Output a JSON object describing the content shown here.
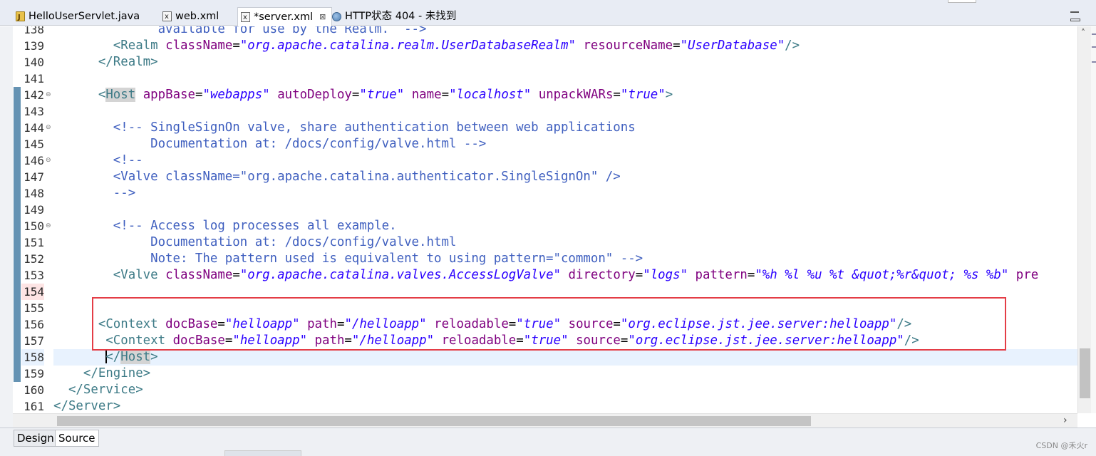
{
  "tabs": [
    {
      "label": "HelloUserServlet.java",
      "icon": "java-file-icon",
      "active": false
    },
    {
      "label": "web.xml",
      "icon": "xml-file-icon",
      "active": false
    },
    {
      "label": "*server.xml",
      "icon": "xml-file-icon",
      "active": true,
      "close": "⊠"
    },
    {
      "label": "HTTP状态 404 - 未找到",
      "icon": "web-browser-icon",
      "active": false
    }
  ],
  "editor": {
    "lines": [
      {
        "num": "138",
        "fold": "",
        "segments": [
          {
            "t": "cmt",
            "v": "              available for use by the Realm.  -->"
          }
        ]
      },
      {
        "num": "139",
        "fold": "",
        "segments": [
          {
            "t": "txt",
            "v": "        "
          },
          {
            "t": "bkt",
            "v": "<"
          },
          {
            "t": "tag",
            "v": "Realm"
          },
          {
            "t": "txt",
            "v": " "
          },
          {
            "t": "attr",
            "v": "className"
          },
          {
            "t": "txt",
            "v": "="
          },
          {
            "t": "val",
            "v": "\"org.apache.catalina.realm.UserDatabaseRealm\""
          },
          {
            "t": "txt",
            "v": " "
          },
          {
            "t": "attr",
            "v": "resourceName"
          },
          {
            "t": "txt",
            "v": "="
          },
          {
            "t": "val",
            "v": "\"UserDatabase\""
          },
          {
            "t": "bkt",
            "v": "/>"
          }
        ]
      },
      {
        "num": "140",
        "fold": "",
        "segments": [
          {
            "t": "txt",
            "v": "      "
          },
          {
            "t": "bkt",
            "v": "</"
          },
          {
            "t": "tag",
            "v": "Realm"
          },
          {
            "t": "bkt",
            "v": ">"
          }
        ]
      },
      {
        "num": "141",
        "fold": "",
        "segments": []
      },
      {
        "num": "142",
        "fold": "⊖",
        "segments": [
          {
            "t": "txt",
            "v": "      "
          },
          {
            "t": "bkt",
            "v": "<"
          },
          {
            "t": "taghl",
            "v": "Host"
          },
          {
            "t": "txt",
            "v": " "
          },
          {
            "t": "attr",
            "v": "appBase"
          },
          {
            "t": "txt",
            "v": "="
          },
          {
            "t": "val",
            "v": "\"webapps\""
          },
          {
            "t": "txt",
            "v": " "
          },
          {
            "t": "attr",
            "v": "autoDeploy"
          },
          {
            "t": "txt",
            "v": "="
          },
          {
            "t": "val",
            "v": "\"true\""
          },
          {
            "t": "txt",
            "v": " "
          },
          {
            "t": "attr",
            "v": "name"
          },
          {
            "t": "txt",
            "v": "="
          },
          {
            "t": "val",
            "v": "\"localhost\""
          },
          {
            "t": "txt",
            "v": " "
          },
          {
            "t": "attr",
            "v": "unpackWARs"
          },
          {
            "t": "txt",
            "v": "="
          },
          {
            "t": "val",
            "v": "\"true\""
          },
          {
            "t": "bkt",
            "v": ">"
          }
        ]
      },
      {
        "num": "143",
        "fold": "",
        "segments": []
      },
      {
        "num": "144",
        "fold": "⊖",
        "segments": [
          {
            "t": "cmt",
            "v": "        <!-- SingleSignOn valve, share authentication between web applications"
          }
        ]
      },
      {
        "num": "145",
        "fold": "",
        "segments": [
          {
            "t": "cmt",
            "v": "             Documentation at: /docs/config/valve.html -->"
          }
        ]
      },
      {
        "num": "146",
        "fold": "⊖",
        "segments": [
          {
            "t": "cmt",
            "v": "        <!--"
          }
        ]
      },
      {
        "num": "147",
        "fold": "",
        "segments": [
          {
            "t": "cmt",
            "v": "        <Valve className=\"org.apache.catalina.authenticator.SingleSignOn\" />"
          }
        ]
      },
      {
        "num": "148",
        "fold": "",
        "segments": [
          {
            "t": "cmt",
            "v": "        -->"
          }
        ]
      },
      {
        "num": "149",
        "fold": "",
        "segments": []
      },
      {
        "num": "150",
        "fold": "⊖",
        "segments": [
          {
            "t": "cmt",
            "v": "        <!-- Access log processes all example."
          }
        ]
      },
      {
        "num": "151",
        "fold": "",
        "segments": [
          {
            "t": "cmt",
            "v": "             Documentation at: /docs/config/valve.html"
          }
        ]
      },
      {
        "num": "152",
        "fold": "",
        "segments": [
          {
            "t": "cmt",
            "v": "             Note: The pattern used is equivalent to using pattern=\"common\" -->"
          }
        ]
      },
      {
        "num": "153",
        "fold": "",
        "segments": [
          {
            "t": "txt",
            "v": "        "
          },
          {
            "t": "bkt",
            "v": "<"
          },
          {
            "t": "tag",
            "v": "Valve"
          },
          {
            "t": "txt",
            "v": " "
          },
          {
            "t": "attr",
            "v": "className"
          },
          {
            "t": "txt",
            "v": "="
          },
          {
            "t": "val",
            "v": "\"org.apache.catalina.valves.AccessLogValve\""
          },
          {
            "t": "txt",
            "v": " "
          },
          {
            "t": "attr",
            "v": "directory"
          },
          {
            "t": "txt",
            "v": "="
          },
          {
            "t": "val",
            "v": "\"logs\""
          },
          {
            "t": "txt",
            "v": " "
          },
          {
            "t": "attr",
            "v": "pattern"
          },
          {
            "t": "txt",
            "v": "="
          },
          {
            "t": "val",
            "v": "\"%h %l %u %t &quot;%r&quot; %s %b\""
          },
          {
            "t": "txt",
            "v": " "
          },
          {
            "t": "attr",
            "v": "pre"
          }
        ]
      },
      {
        "num": "154",
        "fold": "",
        "dirty": true,
        "segments": []
      },
      {
        "num": "155",
        "fold": "",
        "segments": []
      },
      {
        "num": "156",
        "fold": "",
        "segments": [
          {
            "t": "txt",
            "v": "      "
          },
          {
            "t": "bkt",
            "v": "<"
          },
          {
            "t": "tag",
            "v": "Context"
          },
          {
            "t": "txt",
            "v": " "
          },
          {
            "t": "attr",
            "v": "docBase"
          },
          {
            "t": "txt",
            "v": "="
          },
          {
            "t": "val",
            "v": "\"helloapp\""
          },
          {
            "t": "txt",
            "v": " "
          },
          {
            "t": "attr",
            "v": "path"
          },
          {
            "t": "txt",
            "v": "="
          },
          {
            "t": "val",
            "v": "\"/helloapp\""
          },
          {
            "t": "txt",
            "v": " "
          },
          {
            "t": "attr",
            "v": "reloadable"
          },
          {
            "t": "txt",
            "v": "="
          },
          {
            "t": "val",
            "v": "\"true\""
          },
          {
            "t": "txt",
            "v": " "
          },
          {
            "t": "attr",
            "v": "source"
          },
          {
            "t": "txt",
            "v": "="
          },
          {
            "t": "val",
            "v": "\"org.eclipse.jst.jee.server:helloapp\""
          },
          {
            "t": "bkt",
            "v": "/>"
          }
        ]
      },
      {
        "num": "157",
        "fold": "",
        "segments": [
          {
            "t": "txt",
            "v": "       "
          },
          {
            "t": "bkt",
            "v": "<"
          },
          {
            "t": "tag",
            "v": "Context"
          },
          {
            "t": "txt",
            "v": " "
          },
          {
            "t": "attr",
            "v": "docBase"
          },
          {
            "t": "txt",
            "v": "="
          },
          {
            "t": "val",
            "v": "\"helloapp\""
          },
          {
            "t": "txt",
            "v": " "
          },
          {
            "t": "attr",
            "v": "path"
          },
          {
            "t": "txt",
            "v": "="
          },
          {
            "t": "val",
            "v": "\"/helloapp\""
          },
          {
            "t": "txt",
            "v": " "
          },
          {
            "t": "attr",
            "v": "reloadable"
          },
          {
            "t": "txt",
            "v": "="
          },
          {
            "t": "val",
            "v": "\"true\""
          },
          {
            "t": "txt",
            "v": " "
          },
          {
            "t": "attr",
            "v": "source"
          },
          {
            "t": "txt",
            "v": "="
          },
          {
            "t": "val",
            "v": "\"org.eclipse.jst.jee.server:helloapp\""
          },
          {
            "t": "bkt",
            "v": "/>"
          }
        ]
      },
      {
        "num": "158",
        "fold": "",
        "current": true,
        "segments": [
          {
            "t": "txt",
            "v": "       "
          },
          {
            "t": "caret",
            "v": ""
          },
          {
            "t": "bkt",
            "v": "</"
          },
          {
            "t": "taghl",
            "v": "Host"
          },
          {
            "t": "bkt",
            "v": ">"
          }
        ]
      },
      {
        "num": "159",
        "fold": "",
        "segments": [
          {
            "t": "txt",
            "v": "    "
          },
          {
            "t": "bkt",
            "v": "</"
          },
          {
            "t": "tag",
            "v": "Engine"
          },
          {
            "t": "bkt",
            "v": ">"
          }
        ]
      },
      {
        "num": "160",
        "fold": "",
        "segments": [
          {
            "t": "txt",
            "v": "  "
          },
          {
            "t": "bkt",
            "v": "</"
          },
          {
            "t": "tag",
            "v": "Service"
          },
          {
            "t": "bkt",
            "v": ">"
          }
        ]
      },
      {
        "num": "161",
        "fold": "",
        "segments": [
          {
            "t": "bkt",
            "v": "</"
          },
          {
            "t": "tag",
            "v": "Server"
          },
          {
            "t": "bkt",
            "v": ">"
          }
        ]
      }
    ]
  },
  "bottom_tabs": [
    {
      "label": "Design",
      "active": false
    },
    {
      "label": "Source",
      "active": true
    }
  ],
  "watermark": "CSDN @禾火r",
  "colors": {
    "tag": "#3e7b87",
    "attr": "#7f007f",
    "value": "#2a00ff",
    "comment": "#3f5fbf",
    "highlight_box": "#e43d46",
    "current_line": "#e8f2fe"
  }
}
